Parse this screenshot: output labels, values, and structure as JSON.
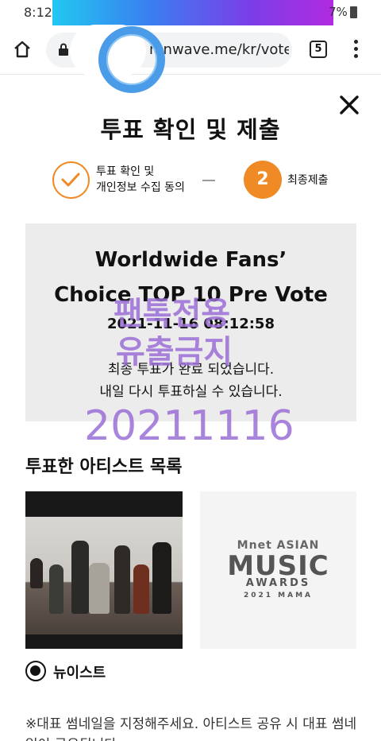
{
  "status_bar": {
    "time": "8:12",
    "battery": "7%"
  },
  "browser": {
    "url": "mnwave.me/kr/vote#step",
    "tabs_count": "5"
  },
  "header": {
    "title": "투표 확인 및 제출"
  },
  "steps": {
    "step1_label_line1": "투표 확인 및",
    "step1_label_line2": "개인정보 수집 동의",
    "step2_number": "2",
    "step2_label": "최종제출"
  },
  "result": {
    "title_line1": "Worldwide Fans’",
    "title_line2": "Choice TOP 10 Pre Vote",
    "timestamp": "2021-11-16 08:12:58",
    "message_line1": "최종 투표가 완료 되었습니다.",
    "message_line2": "내일 다시 투표하실 수 있습니다."
  },
  "watermark": {
    "line1": "팬톡전용",
    "line2": "유출금지",
    "line3": "20211116"
  },
  "artists": {
    "section_title": "투표한 아티스트 목록",
    "selected_artist": "뉴이스트",
    "logo_line1": "Mnet ASIAN",
    "logo_line2": "MUSIC",
    "logo_line3": "AWARDS",
    "logo_line4": "2021 MAMA"
  },
  "notice": {
    "text": "※대표 썸네일을 지정해주세요. 아티스트 공유 시 대표 썸네일이 공유됩니다."
  },
  "colors": {
    "accent": "#f08a24",
    "watermark": "#9b6fd6",
    "result_bg": "#ececec"
  }
}
